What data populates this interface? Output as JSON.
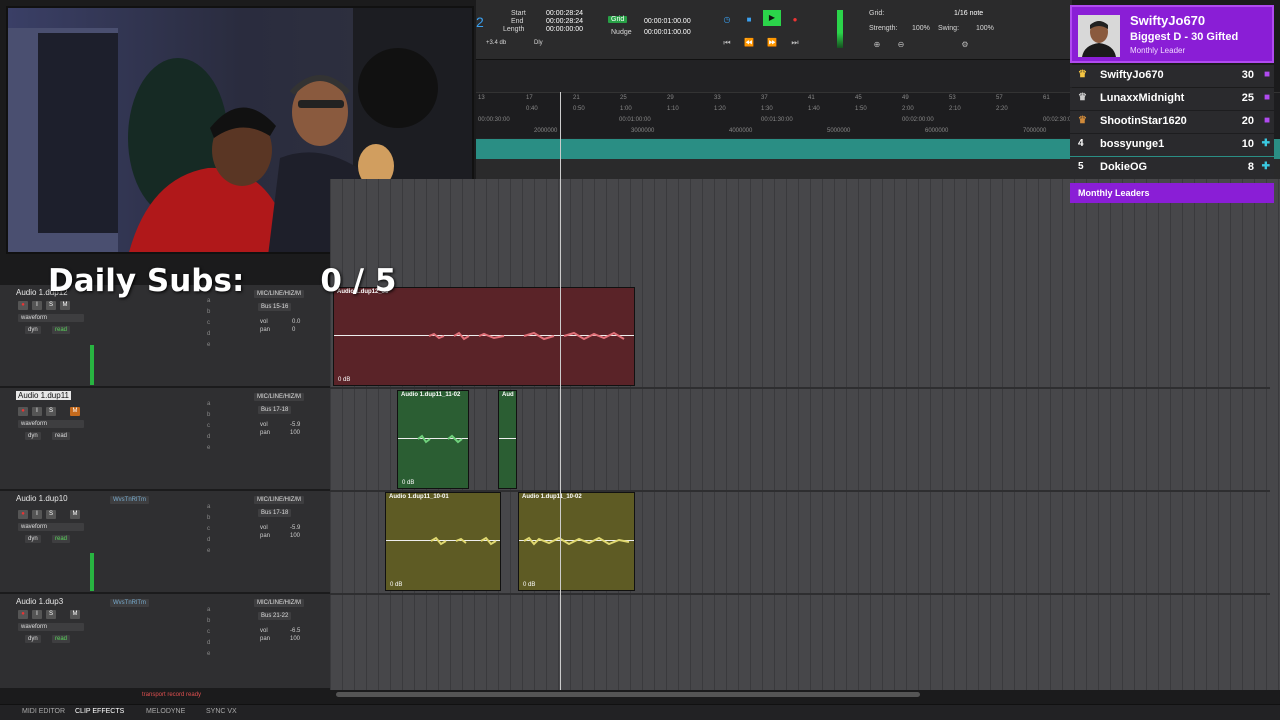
{
  "overlay": {
    "daily_subs_label": "Daily Subs:",
    "daily_subs_count": "0 / 5"
  },
  "transport": {
    "counter_partial": "2",
    "start_label": "Start",
    "start_value": "00:00:28:24",
    "end_label": "End",
    "end_value": "00:00:28:24",
    "length_label": "Length",
    "length_value": "00:00:00:00",
    "gain": "+3.4 db",
    "dly": "Dly",
    "grid_badge": "Grid",
    "grid_value": "00:00:01:00.00",
    "nudge_label": "Nudge",
    "nudge_value": "00:00:01:00.00",
    "grid_label": "Grid:",
    "note_value": "1/16 note",
    "strength_label": "Strength:",
    "strength_value": "100%",
    "swing_label": "Swing:",
    "swing_value": "100%"
  },
  "ruler": {
    "bars": [
      "13",
      "17",
      "21",
      "25",
      "29",
      "33",
      "37",
      "41",
      "45",
      "49",
      "53",
      "57",
      "61"
    ],
    "bar_sub": [
      "0:40",
      "0:40",
      "0:50",
      "1:00",
      "1:10",
      "1:20",
      "1:30",
      "1:40",
      "1:50",
      "2:00",
      "2:10",
      "2:20"
    ],
    "timecodes": [
      "00:00:30:00",
      "00:01:00:00",
      "00:01:30:00",
      "00:02:00:00",
      "00:02:30:00"
    ],
    "samples": [
      "2000000",
      "3000000",
      "4000000",
      "5000000",
      "6000000",
      "7000000"
    ]
  },
  "tracks": [
    {
      "name": "Audio 1.dup12",
      "selected": false,
      "output": "MIC/LINE/HIZ/M",
      "bus": "Bus 15-16",
      "vol": "0.0",
      "pan": "0",
      "insert": "",
      "mode": "waveform",
      "auto": "read",
      "dyn": "dyn"
    },
    {
      "name": "Audio 1.dup11",
      "selected": true,
      "output": "MIC/LINE/HIZ/M",
      "bus": "Bus 17-18",
      "vol": "-5.9",
      "pan": "100",
      "insert": "",
      "mode": "waveform",
      "auto": "read",
      "dyn": "dyn"
    },
    {
      "name": "Audio 1.dup10",
      "selected": false,
      "output": "MIC/LINE/HIZ/M",
      "bus": "Bus 17-18",
      "vol": "-5.9",
      "pan": "100",
      "insert": "WvsTnRlTm",
      "mode": "waveform",
      "auto": "read",
      "dyn": "dyn"
    },
    {
      "name": "Audio 1.dup3",
      "selected": false,
      "output": "MIC/LINE/HIZ/M",
      "bus": "Bus 21-22",
      "vol": "-6.5",
      "pan": "100",
      "insert": "WvsTnRlTm",
      "mode": "waveform",
      "auto": "read",
      "dyn": "dyn"
    }
  ],
  "track_labels": {
    "vol": "vol",
    "pan": "pan",
    "sends": [
      "a",
      "b",
      "c",
      "d",
      "e"
    ],
    "solo": "S",
    "mute": "M",
    "inserts": [
      "A",
      "B",
      "C",
      "D",
      "E"
    ]
  },
  "clips": [
    {
      "name": "Audio 1.dup12_35",
      "db": "0 dB"
    },
    {
      "name": "Audio 1.dup11_11-02",
      "db": "0 dB"
    },
    {
      "name": "Aud",
      "db": ""
    },
    {
      "name": "Audio 1.dup11_10-01",
      "db": "0 dB"
    },
    {
      "name": "Audio 1.dup11_10-02",
      "db": "0 dB"
    }
  ],
  "leaderboard": {
    "top_name": "SwiftyJo670",
    "top_sub": "Biggest D - 30 Gifted",
    "top_caption": "Monthly Leader",
    "rows": [
      {
        "rank": "1",
        "name": "SwiftyJo670",
        "score": "30"
      },
      {
        "rank": "2",
        "name": "LunaxxMidnight",
        "score": "25"
      },
      {
        "rank": "3",
        "name": "ShootinStar1620",
        "score": "20"
      },
      {
        "rank": "4",
        "name": "bossyunge1",
        "score": "10"
      },
      {
        "rank": "5",
        "name": "DokieOG",
        "score": "8"
      }
    ],
    "footer": "Monthly Leaders",
    "accent": "#8a1ed6"
  },
  "status": "transport record ready",
  "bottom_tabs": [
    "MIDI EDITOR",
    "CLIP EFFECTS",
    "MELODYNE",
    "SYNC VX"
  ]
}
